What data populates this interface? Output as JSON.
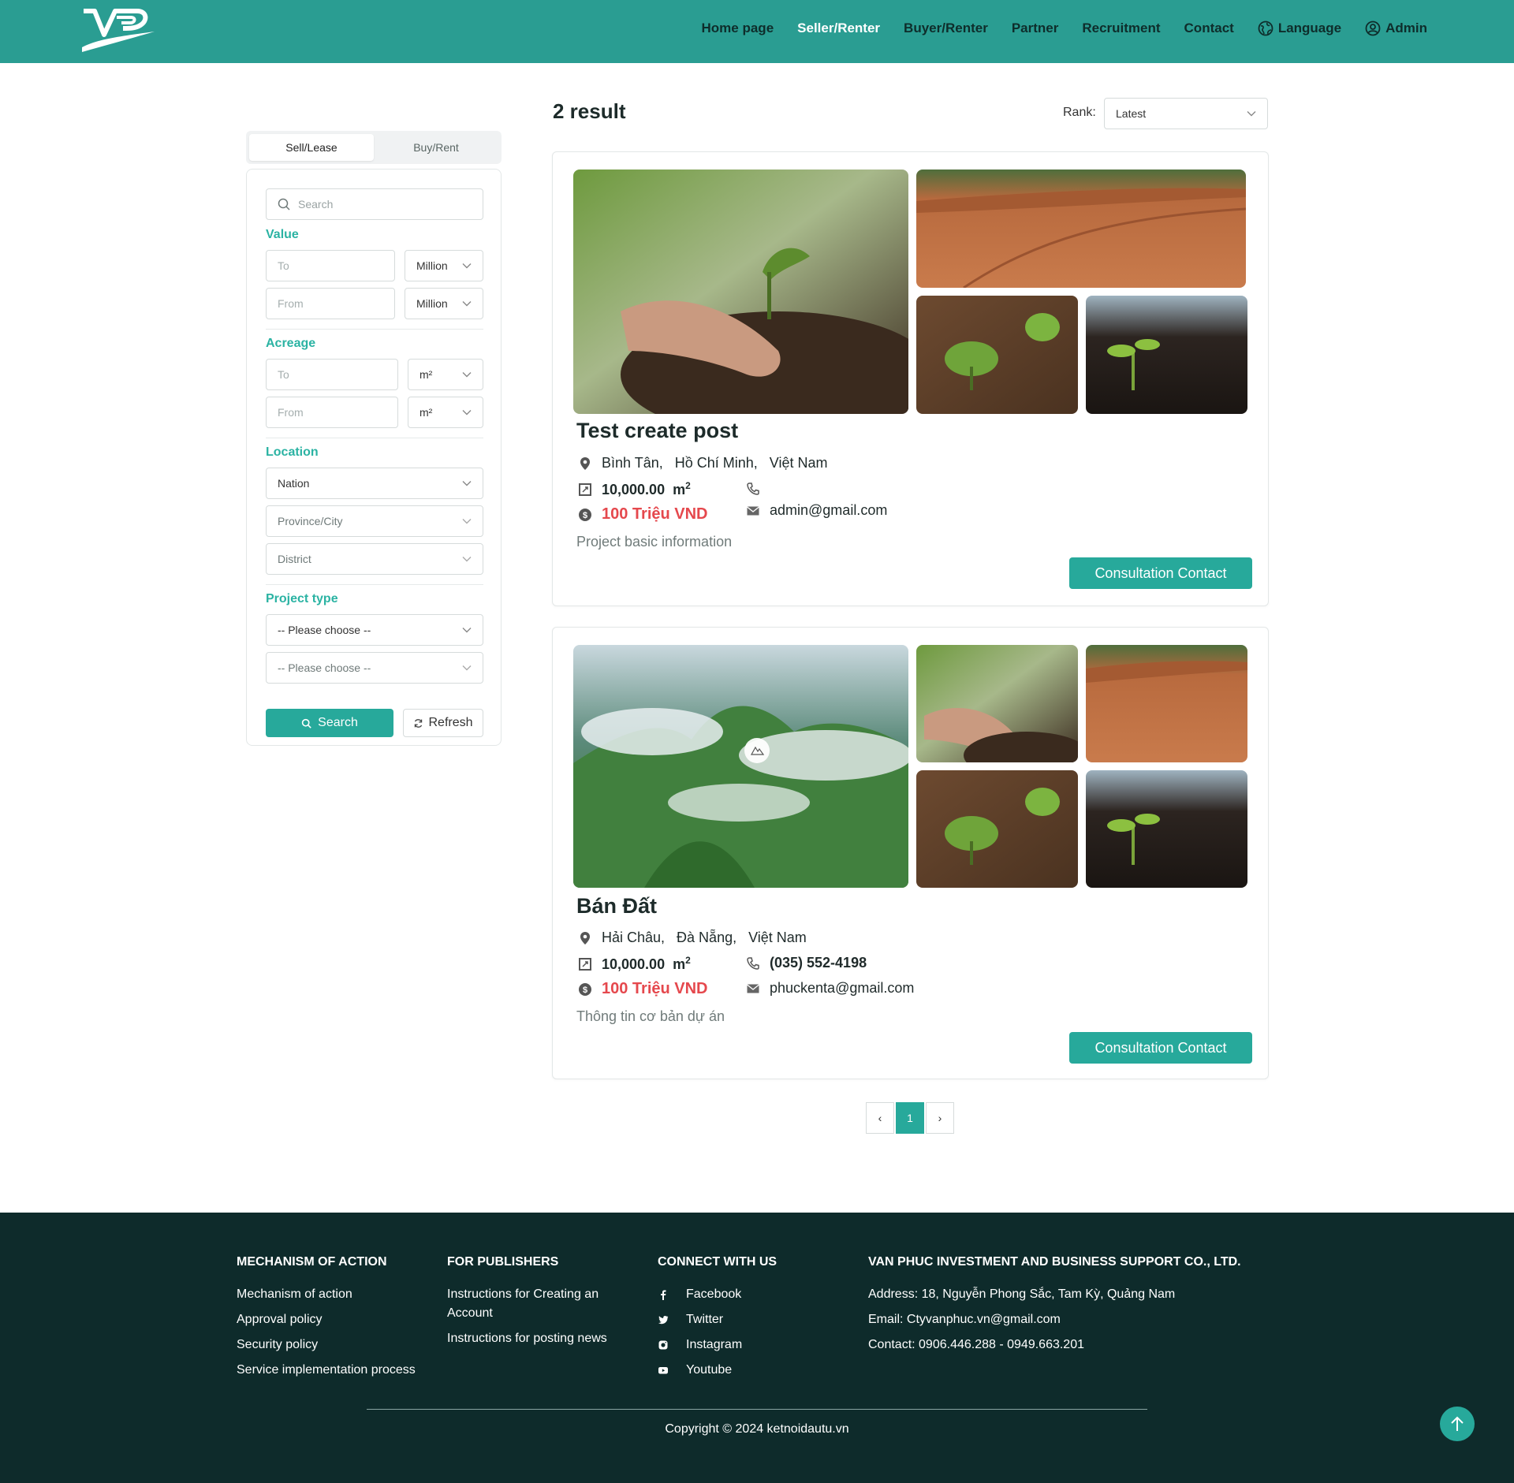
{
  "colors": {
    "brand": "#2a9d92",
    "accent": "#27a99b",
    "label": "#2bb3a3",
    "price": "#e5484d",
    "footer": "#0e2b2b"
  },
  "header": {
    "logo_icon": "vp-logo",
    "nav": [
      {
        "label": "Home page",
        "active": false
      },
      {
        "label": "Seller/Renter",
        "active": true
      },
      {
        "label": "Buyer/Renter",
        "active": false
      },
      {
        "label": "Partner",
        "active": false
      },
      {
        "label": "Recruitment",
        "active": false
      },
      {
        "label": "Contact",
        "active": false
      },
      {
        "label": "Language",
        "icon": "globe-icon"
      },
      {
        "label": "Admin",
        "icon": "user-circle-icon"
      }
    ]
  },
  "sidebar": {
    "tabs": [
      {
        "label": "Sell/Lease",
        "active": true
      },
      {
        "label": "Buy/Rent",
        "active": false
      }
    ],
    "search_placeholder": "Search",
    "value": {
      "label": "Value",
      "to_placeholder": "To",
      "from_placeholder": "From",
      "unit_to": "Million",
      "unit_from": "Million"
    },
    "acreage": {
      "label": "Acreage",
      "to_placeholder": "To",
      "from_placeholder": "From",
      "unit_to": "m²",
      "unit_from": "m²"
    },
    "location": {
      "label": "Location",
      "nation": "Nation",
      "province": "Province/City",
      "district": "District"
    },
    "project_type": {
      "label": "Project type",
      "select1": "-- Please choose --",
      "select2": "-- Please choose --"
    },
    "search_button": "Search",
    "refresh_button": "Refresh"
  },
  "results": {
    "count_text": "2 result",
    "rank_label": "Rank:",
    "rank_value": "Latest",
    "cards": [
      {
        "title": "Test create post",
        "location": "Bình Tân,   Hồ Chí Minh,   Việt Nam",
        "area": "10,000.00",
        "area_unit": "m",
        "area_sup": "2",
        "price": "100 Triệu VND",
        "phone": "",
        "email": "admin@gmail.com",
        "description": "Project basic information",
        "button": "Consultation Contact"
      },
      {
        "title": "Bán Đất",
        "location": "Hải Châu,   Đà Nẵng,   Việt Nam",
        "area": "10,000.00",
        "area_unit": "m",
        "area_sup": "2",
        "price": "100 Triệu VND",
        "phone": "(035) 552-4198",
        "email": "phuckenta@gmail.com",
        "description": "Thông tin cơ bản dự án",
        "button": "Consultation Contact"
      }
    ]
  },
  "pagination": {
    "prev": "‹",
    "current": "1",
    "next": "›"
  },
  "footer": {
    "col1": {
      "title": "MECHANISM OF ACTION",
      "links": [
        "Mechanism of action",
        "Approval policy",
        "Security policy",
        "Service implementation process"
      ]
    },
    "col2": {
      "title": "FOR PUBLISHERS",
      "links": [
        "Instructions for Creating an Account",
        "Instructions for posting news"
      ]
    },
    "col3": {
      "title": "CONNECT WITH US",
      "links": [
        "Facebook",
        "Twitter",
        "Instagram",
        "Youtube"
      ]
    },
    "col4": {
      "title": "VAN PHUC INVESTMENT AND BUSINESS SUPPORT CO., LTD.",
      "lines": [
        "Address: 18, Nguyễn Phong Sắc, Tam Kỳ, Quảng Nam",
        "Email: Ctyvanphuc.vn@gmail.com",
        "Contact: 0906.446.288 - 0949.663.201"
      ]
    },
    "copyright": "Copyright © 2024 ketnoidautu.vn"
  }
}
